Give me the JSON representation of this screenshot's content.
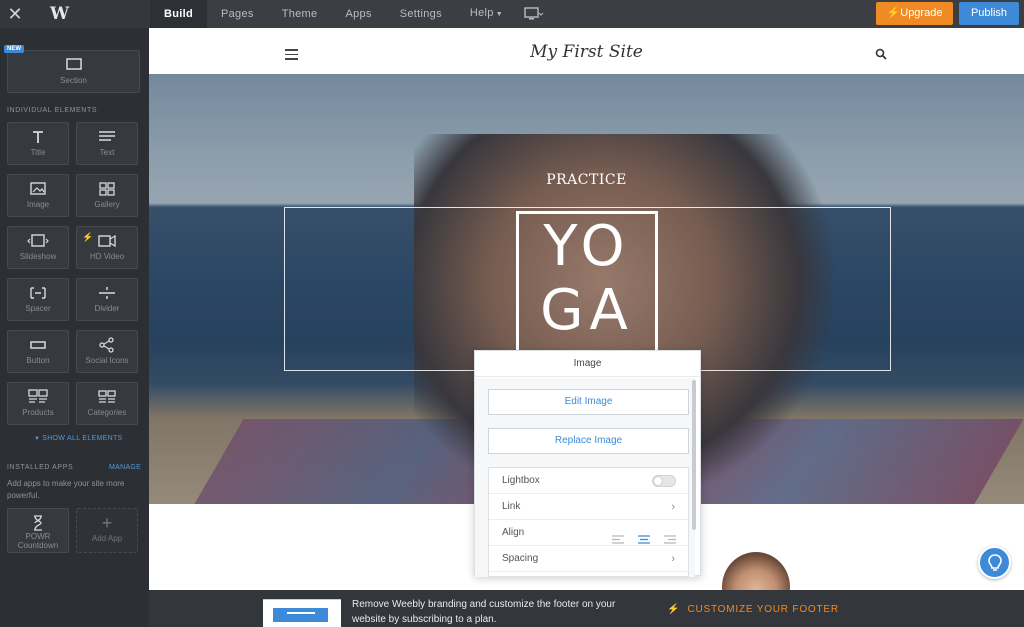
{
  "topbar": {
    "nav": [
      "Build",
      "Pages",
      "Theme",
      "Apps",
      "Settings",
      "Help"
    ],
    "upgrade": "Upgrade",
    "publish": "Publish"
  },
  "sidebar": {
    "new_badge": "NEW",
    "section_label": "Section",
    "individual_heading": "INDIVIDUAL ELEMENTS",
    "elements": [
      "Title",
      "Text",
      "Image",
      "Gallery",
      "Slideshow",
      "HD Video",
      "Spacer",
      "Divider",
      "Button",
      "Social Icons",
      "Products",
      "Categories"
    ],
    "show_all": "SHOW ALL ELEMENTS",
    "installed_heading": "INSTALLED APPS",
    "manage": "MANAGE",
    "apps_text": "Add apps to make your site more powerful.",
    "apps": [
      "POWR Countdown",
      "Add App"
    ]
  },
  "site": {
    "title": "My First Site",
    "hero_kicker": "PRACTICE",
    "hero_word_1": "YO",
    "hero_word_2": "GA"
  },
  "panel": {
    "title": "Image",
    "edit": "Edit Image",
    "replace": "Replace Image",
    "rows": [
      "Lightbox",
      "Link",
      "Align",
      "Spacing"
    ],
    "lightbox_on": false,
    "align_selected": "center"
  },
  "banner": {
    "text": "Remove Weebly branding and customize the footer on your website by subscribing to a plan.",
    "cta": "CUSTOMIZE YOUR FOOTER"
  },
  "colors": {
    "accent": "#3d8bd8",
    "upgrade": "#f08a24"
  }
}
